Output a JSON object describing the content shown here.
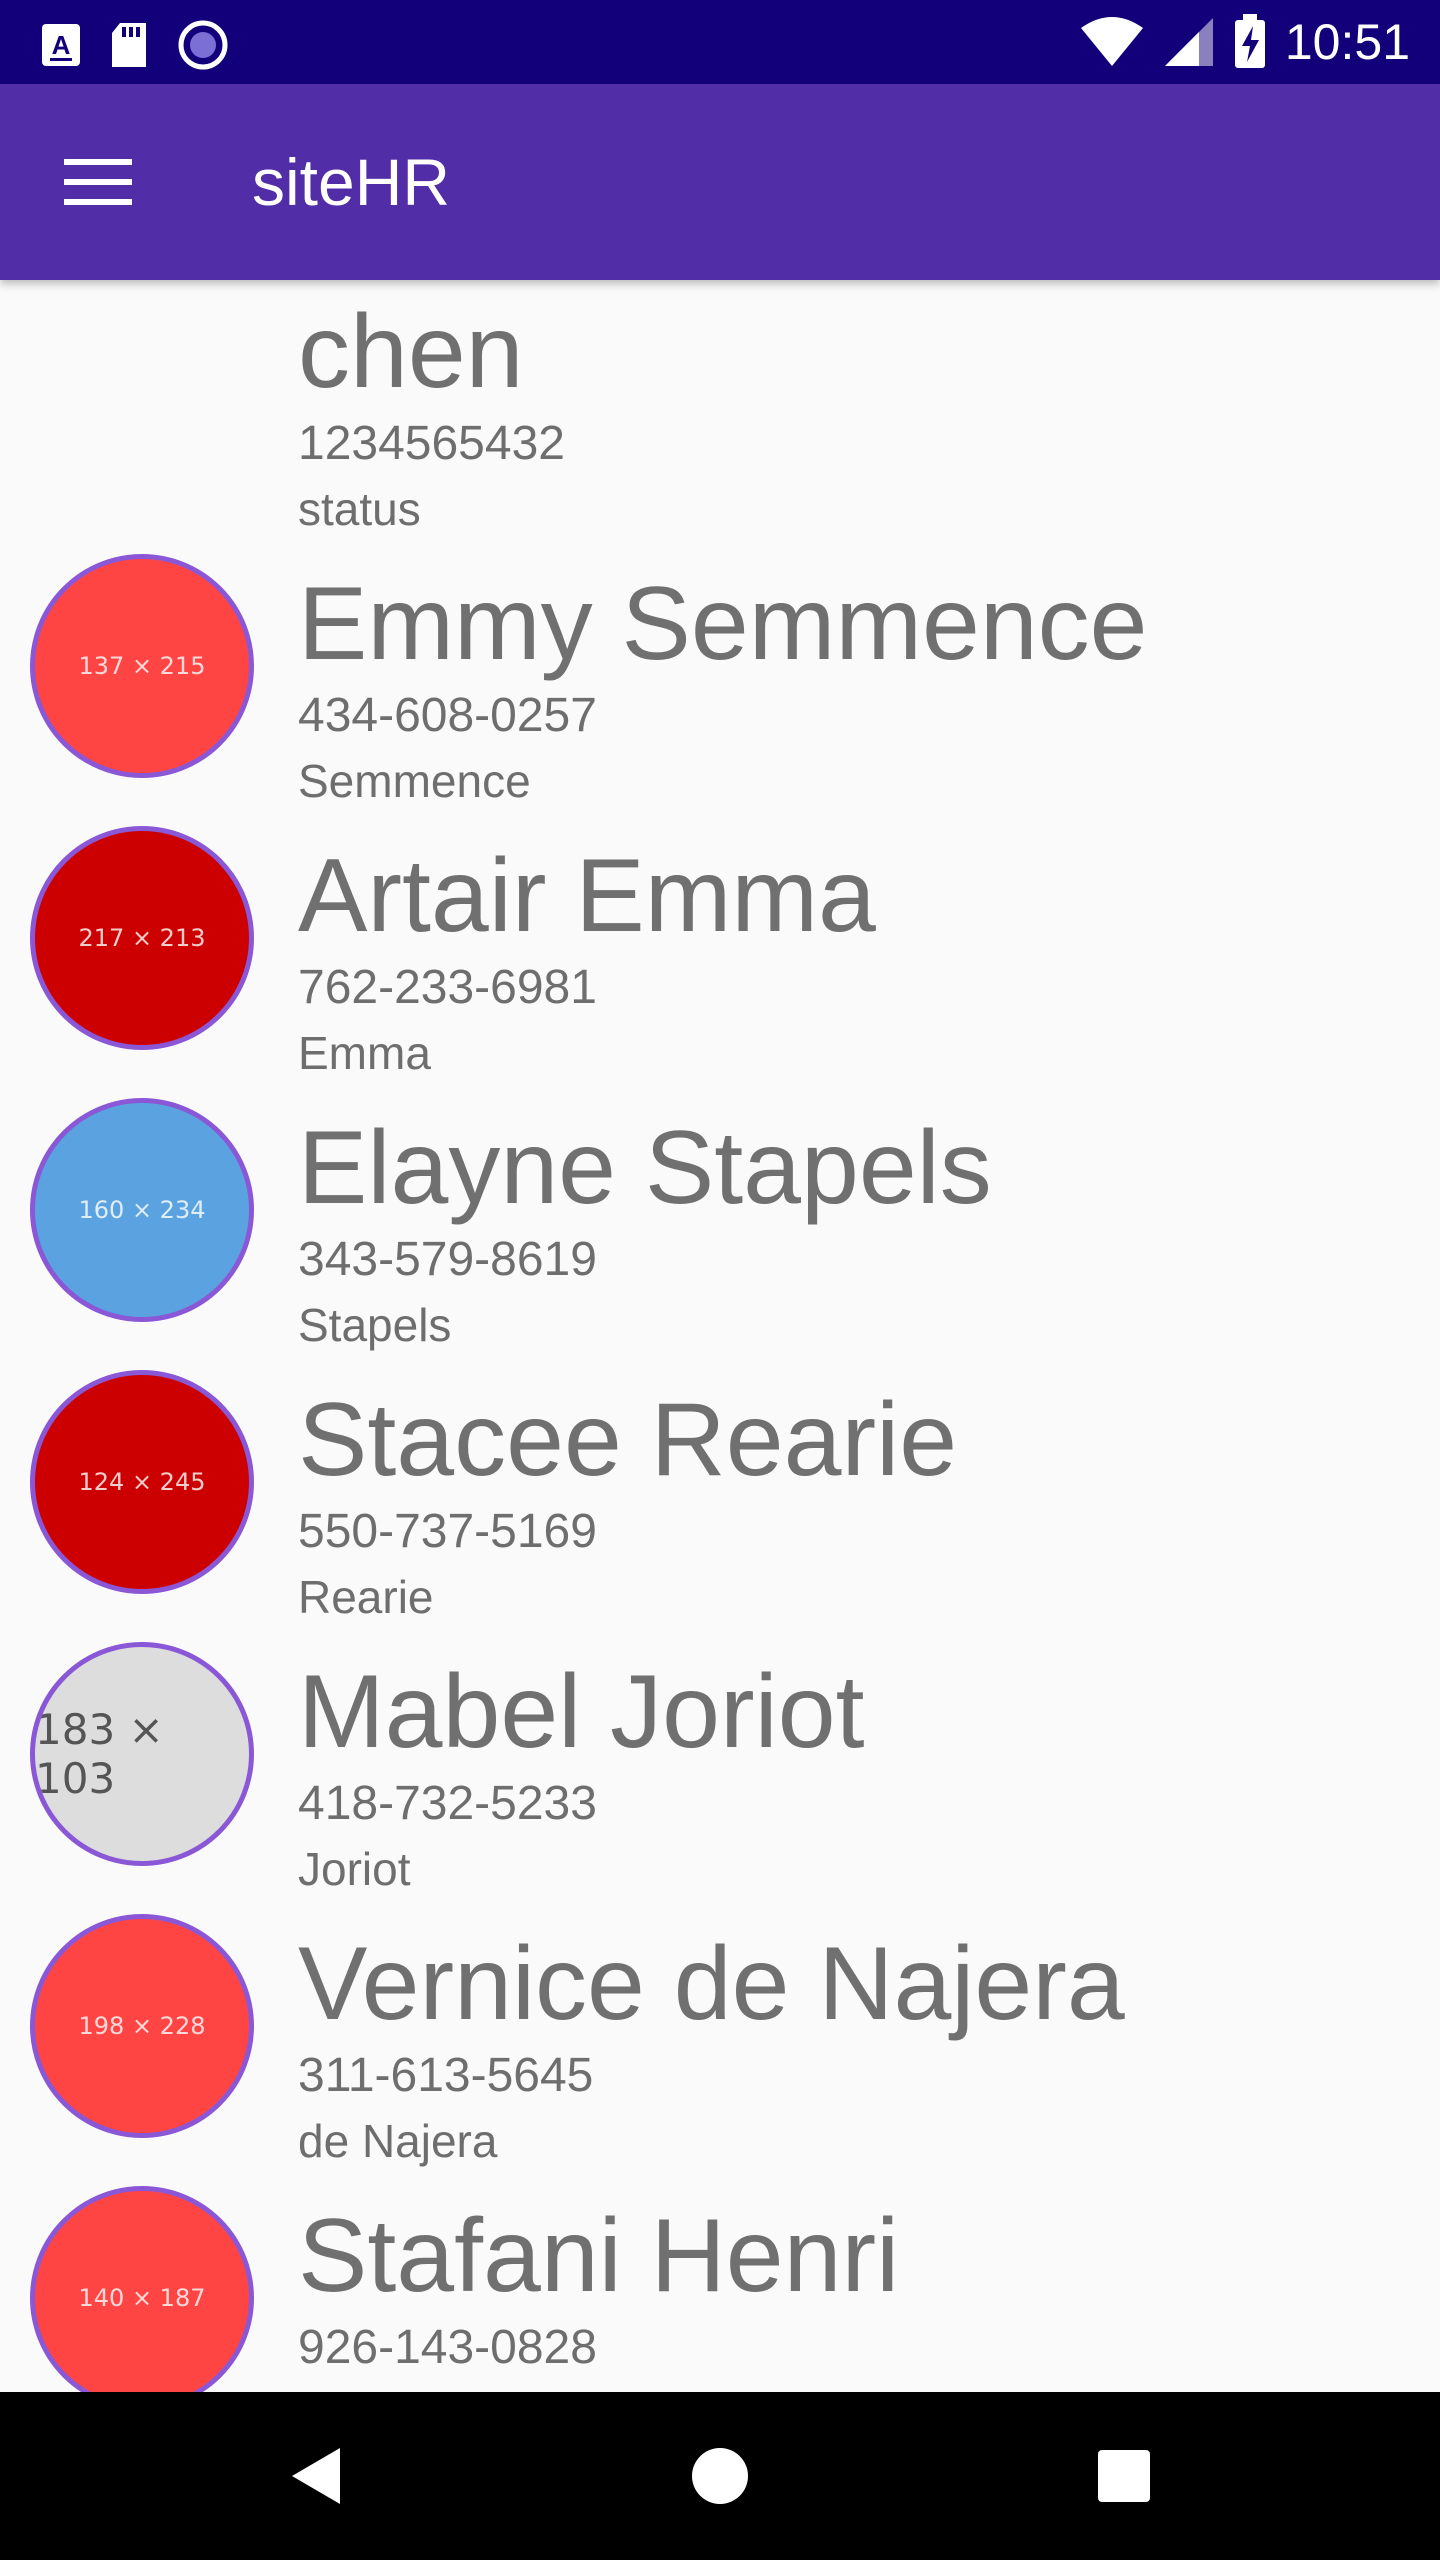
{
  "status_bar": {
    "time": "10:51",
    "left_icons": [
      "keyboard-a-icon",
      "sd-card-icon",
      "record-circle-icon"
    ],
    "right_icons": [
      "wifi-icon",
      "cell-signal-icon",
      "battery-charging-icon"
    ]
  },
  "app_bar": {
    "title": "siteHR",
    "menu_icon": "hamburger-menu-icon"
  },
  "contacts": [
    {
      "name": "chen",
      "phone": "1234565432",
      "subtitle": "status",
      "avatar": null
    },
    {
      "name": "Emmy Semmence",
      "phone": "434-608-0257",
      "subtitle": "Semmence",
      "avatar": {
        "label": "137 × 215",
        "color": "#ff4444"
      }
    },
    {
      "name": "Artair Emma",
      "phone": "762-233-6981",
      "subtitle": "Emma",
      "avatar": {
        "label": "217 × 213",
        "color": "#cc0000"
      }
    },
    {
      "name": "Elayne Stapels",
      "phone": "343-579-8619",
      "subtitle": "Stapels",
      "avatar": {
        "label": "160 × 234",
        "color": "#5ba3e0"
      }
    },
    {
      "name": "Stacee Rearie",
      "phone": "550-737-5169",
      "subtitle": "Rearie",
      "avatar": {
        "label": "124 × 245",
        "color": "#cc0000"
      }
    },
    {
      "name": "Mabel Joriot",
      "phone": "418-732-5233",
      "subtitle": "Joriot",
      "avatar": {
        "label": "183 × 103",
        "color": "#dddddd"
      }
    },
    {
      "name": "Vernice de Najera",
      "phone": "311-613-5645",
      "subtitle": "de Najera",
      "avatar": {
        "label": "198 × 228",
        "color": "#ff4444"
      }
    },
    {
      "name": "Stafani Henri",
      "phone": "926-143-0828",
      "subtitle": "",
      "avatar": {
        "label": "140 × 187",
        "color": "#ff4444"
      }
    }
  ],
  "nav_bar": {
    "buttons": [
      "back-icon",
      "home-icon",
      "recents-icon"
    ]
  },
  "colors": {
    "status_bar": "#12007a",
    "app_bar": "#512da8",
    "avatar_border": "#8a58d6",
    "text": "#707070"
  }
}
